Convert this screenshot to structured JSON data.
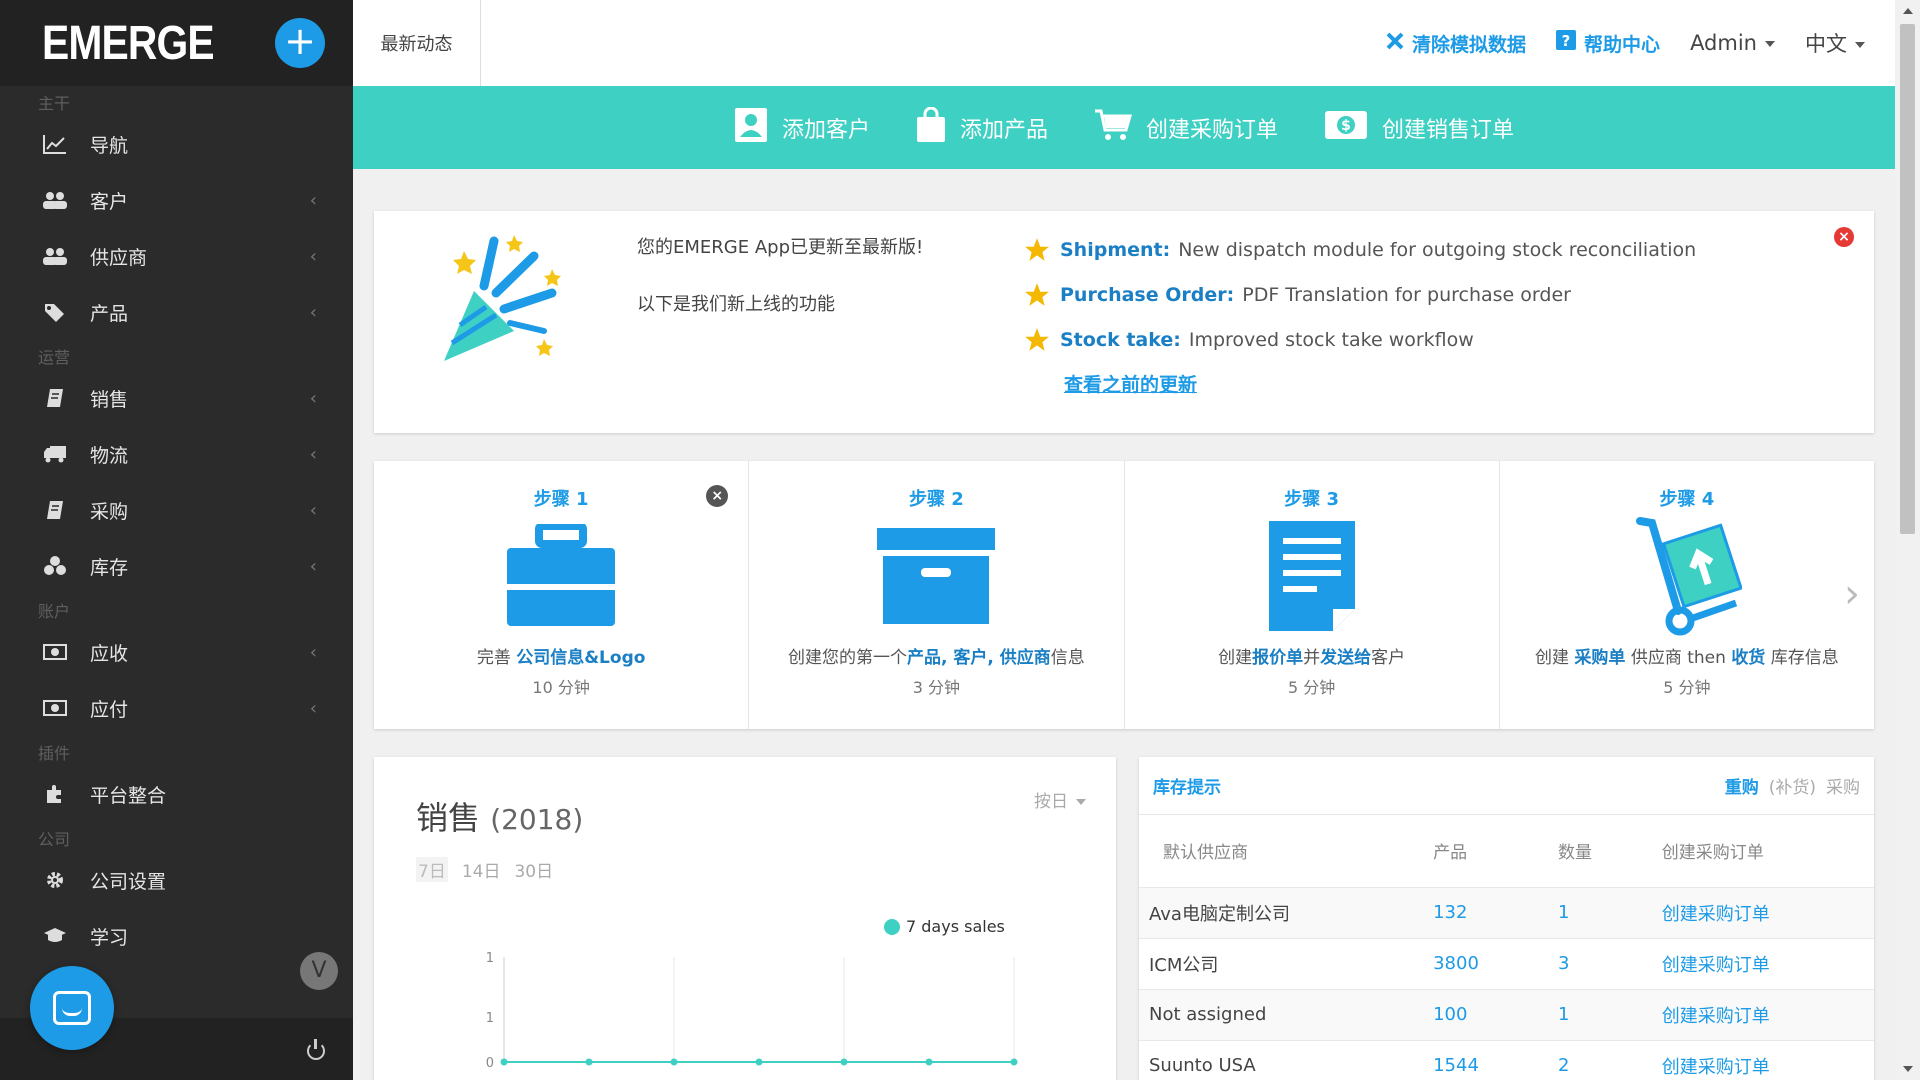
{
  "sidebar": {
    "logo": "EMERGE",
    "add_symbol": "+",
    "sections": {
      "main": "主干",
      "ops": "运营",
      "account": "账户",
      "plugins": "插件",
      "company": "公司"
    },
    "items": {
      "nav": "导航",
      "customers": "客户",
      "suppliers": "供应商",
      "products": "产品",
      "sales": "销售",
      "logistics": "物流",
      "purchase": "采购",
      "inventory": "库存",
      "receivable": "应收",
      "payable": "应付",
      "integration": "平台整合",
      "company_settings": "公司设置",
      "learning": "学习"
    },
    "chevron": "‹",
    "collapse": "V"
  },
  "topbar": {
    "news_tab": "最新动态",
    "clear_demo": "清除模拟数据",
    "help": "帮助中心",
    "user": "Admin",
    "language": "中文"
  },
  "actionbar": {
    "add_customer": "添加客户",
    "add_product": "添加产品",
    "create_po": "创建采购订单",
    "create_so": "创建销售订单"
  },
  "update": {
    "message_line1": "您的EMERGE App已更新至最新版!",
    "message_line2": "以下是我们新上线的功能",
    "features": [
      {
        "title": "Shipment:",
        "desc": "New dispatch module for outgoing stock reconciliation"
      },
      {
        "title": "Purchase Order:",
        "desc": "PDF Translation for purchase order"
      },
      {
        "title": "Stock take:",
        "desc": "Improved stock take workflow"
      }
    ],
    "history_link": "查看之前的更新",
    "close": "×"
  },
  "steps": [
    {
      "title": "步骤 1",
      "desc_pre": "完善 ",
      "desc_bold": "公司信息&Logo",
      "desc_post": "",
      "time": "10 分钟"
    },
    {
      "title": "步骤 2",
      "desc_pre": "创建您的第一个",
      "desc_bold": "产品, 客户, 供应商",
      "desc_post": "信息",
      "time": "3 分钟"
    },
    {
      "title": "步骤 3",
      "desc_pre": "创建",
      "desc_bold": "报价单",
      "desc_mid": "并",
      "desc_bold2": "发送给",
      "desc_post": "客户",
      "time": "5 分钟"
    },
    {
      "title": "步骤 4",
      "desc_pre": "创建 ",
      "desc_bold": "采购单",
      "desc_mid": " 供应商 then ",
      "desc_bold2": "收货",
      "desc_post": " 库存信息",
      "time": "5 分钟"
    }
  ],
  "steps_close": "×",
  "steps_next": "›",
  "sales": {
    "title": "销售",
    "year": "(2018)",
    "by_day": "按日",
    "ranges": [
      "7日",
      "14日",
      "30日"
    ],
    "legend": "7 days sales"
  },
  "chart_data": {
    "type": "line",
    "series": [
      {
        "name": "7 days sales",
        "values": [
          0,
          0,
          0,
          0,
          0,
          0,
          0
        ]
      }
    ],
    "y_tick_labels": [
      "1",
      "1",
      "0"
    ],
    "color": "#3ed0c2"
  },
  "stock": {
    "title": "库存提示",
    "tabs": [
      "重购",
      "(补货)",
      "采购"
    ],
    "columns": [
      "默认供应商",
      "产品",
      "数量",
      "创建采购订单"
    ],
    "rows": [
      {
        "supplier": "Ava电脑定制公司",
        "product": "132",
        "qty": "1",
        "action": "创建采购订单"
      },
      {
        "supplier": "ICM公司",
        "product": "3800",
        "qty": "3",
        "action": "创建采购订单"
      },
      {
        "supplier": "Not assigned",
        "product": "100",
        "qty": "1",
        "action": "创建采购订单"
      },
      {
        "supplier": "Suunto USA",
        "product": "1544",
        "qty": "2",
        "action": "创建采购订单"
      }
    ]
  },
  "colors": {
    "accent": "#1e9be6",
    "teal": "#3ed0c2",
    "sidebar_bg": "#2b2b2b"
  }
}
